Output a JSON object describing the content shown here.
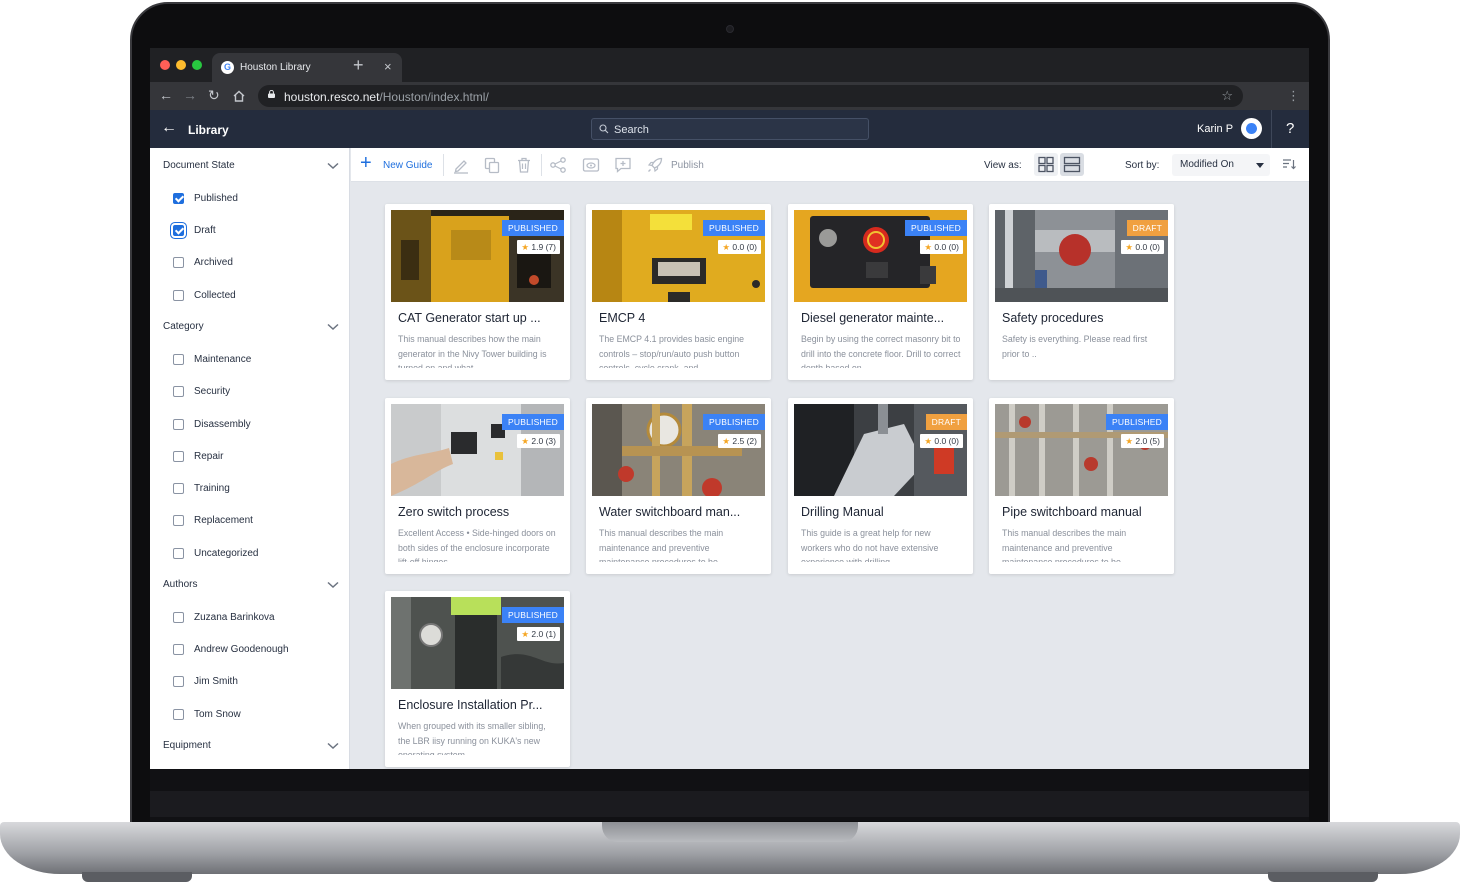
{
  "browser": {
    "tab_title": "Houston Library",
    "url_host": "houston.resco.net",
    "url_path": "/Houston/index.html/"
  },
  "header": {
    "back_label": "Library",
    "search_placeholder": "Search",
    "user_name": "Karin P",
    "help": "?"
  },
  "sidebar": {
    "document_state": {
      "title": "Document State",
      "options": [
        {
          "label": "Published",
          "checked": true
        },
        {
          "label": "Draft",
          "checked": true
        },
        {
          "label": "Archived",
          "checked": false
        },
        {
          "label": "Collected",
          "checked": false
        }
      ]
    },
    "category": {
      "title": "Category",
      "options": [
        {
          "label": "Maintenance",
          "checked": false
        },
        {
          "label": "Security",
          "checked": false
        },
        {
          "label": "Disassembly",
          "checked": false
        },
        {
          "label": "Repair",
          "checked": false
        },
        {
          "label": "Training",
          "checked": false
        },
        {
          "label": "Replacement",
          "checked": false
        },
        {
          "label": "Uncategorized",
          "checked": false
        }
      ]
    },
    "authors": {
      "title": "Authors",
      "options": [
        {
          "label": "Zuzana Barinkova",
          "checked": false
        },
        {
          "label": "Andrew Goodenough",
          "checked": false
        },
        {
          "label": "Jim Smith",
          "checked": false
        },
        {
          "label": "Tom Snow",
          "checked": false
        }
      ]
    },
    "equipment": {
      "title": "Equipment"
    }
  },
  "toolbar": {
    "new_guide": "New Guide",
    "publish": "Publish",
    "view_as": "View as:",
    "sort_by": "Sort by:",
    "sort_value": "Modified On"
  },
  "colors": {
    "accent": "#1f6fde",
    "published": "#3b82f6",
    "draft": "#f0a040",
    "header": "#242c3d"
  },
  "cards": [
    {
      "title": "CAT Generator start up ...",
      "status": "PUBLISHED",
      "rating": "1.9 (7)",
      "desc": "This manual describes how the main generator in the Nivy Tower building is turned on and what"
    },
    {
      "title": "EMCP 4",
      "status": "PUBLISHED",
      "rating": "0.0 (0)",
      "desc": "The EMCP 4.1 provides basic engine controls – stop/run/auto push button controls, cycle crank, and"
    },
    {
      "title": "Diesel generator mainte...",
      "status": "PUBLISHED",
      "rating": "0.0 (0)",
      "desc": "Begin by using the correct masonry bit to drill into the concrete floor. Drill to correct depth based on"
    },
    {
      "title": "Safety procedures",
      "status": "DRAFT",
      "rating": "0.0 (0)",
      "desc": "Safety is everything. Please read first prior to .."
    },
    {
      "title": "Zero switch process",
      "status": "PUBLISHED",
      "rating": "2.0 (3)",
      "desc": "Excellent Access • Side-hinged doors on both sides of the enclosure incorporate lift-off hinges"
    },
    {
      "title": "Water switchboard man...",
      "status": "PUBLISHED",
      "rating": "2.5 (2)",
      "desc": "This manual describes the main maintenance and preventive maintenance procedures to be"
    },
    {
      "title": "Drilling Manual",
      "status": "DRAFT",
      "rating": "0.0 (0)",
      "desc": "This guide is a great help for new workers who do not have extensive experience with drilling"
    },
    {
      "title": "Pipe switchboard manual",
      "status": "PUBLISHED",
      "rating": "2.0 (5)",
      "desc": "This manual describes the main maintenance and preventive maintenance procedures to be"
    },
    {
      "title": "Enclosure Installation Pr...",
      "status": "PUBLISHED",
      "rating": "2.0 (1)",
      "desc": "When grouped with its smaller sibling, the LBR iisy running on KUKA's new operating system"
    }
  ]
}
